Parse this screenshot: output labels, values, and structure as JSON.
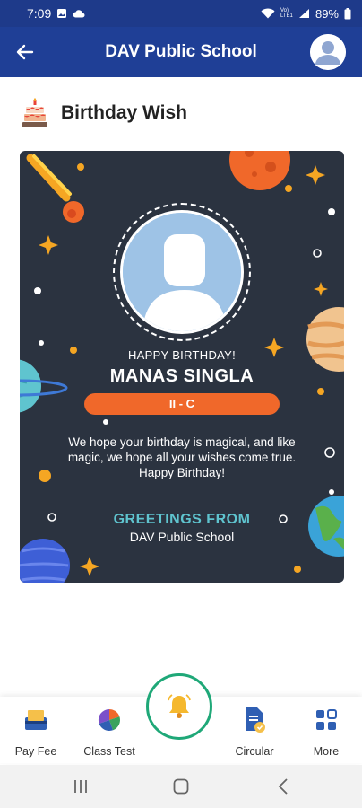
{
  "status_bar": {
    "time": "7:09",
    "battery": "89%",
    "network": "Vo) LTE1"
  },
  "app_bar": {
    "title": "DAV Public School",
    "back_icon": "back-arrow-icon",
    "avatar_icon": "user-avatar-icon",
    "color": "#1f3f96"
  },
  "page": {
    "title": "Birthday Wish",
    "icon": "birthday-cake-icon"
  },
  "card": {
    "happy_birthday": "HAPPY BIRTHDAY!",
    "student_name": "MANAS SINGLA",
    "class_section": "II - C",
    "message": "We hope your birthday is magical, and like magic, we hope all your wishes come true.",
    "message_closing": "Happy Birthday!",
    "greetings_title": "GREETINGS FROM",
    "greetings_school": "DAV Public School",
    "background": "#2b3340",
    "accent_orange": "#f0682a",
    "accent_teal": "#5fc4cf"
  },
  "bottom_nav": {
    "items": [
      {
        "label": "Pay Fee",
        "icon": "pay-fee-icon"
      },
      {
        "label": "Class Test",
        "icon": "pie-chart-icon"
      },
      {
        "label": "Circular",
        "icon": "circular-document-icon"
      },
      {
        "label": "More",
        "icon": "grid-more-icon"
      }
    ],
    "center_icon": "bell-icon",
    "center_ring_color": "#1fa878"
  },
  "system_nav": {
    "recents_icon": "recents-icon",
    "home_icon": "home-icon",
    "back_icon": "system-back-icon"
  }
}
